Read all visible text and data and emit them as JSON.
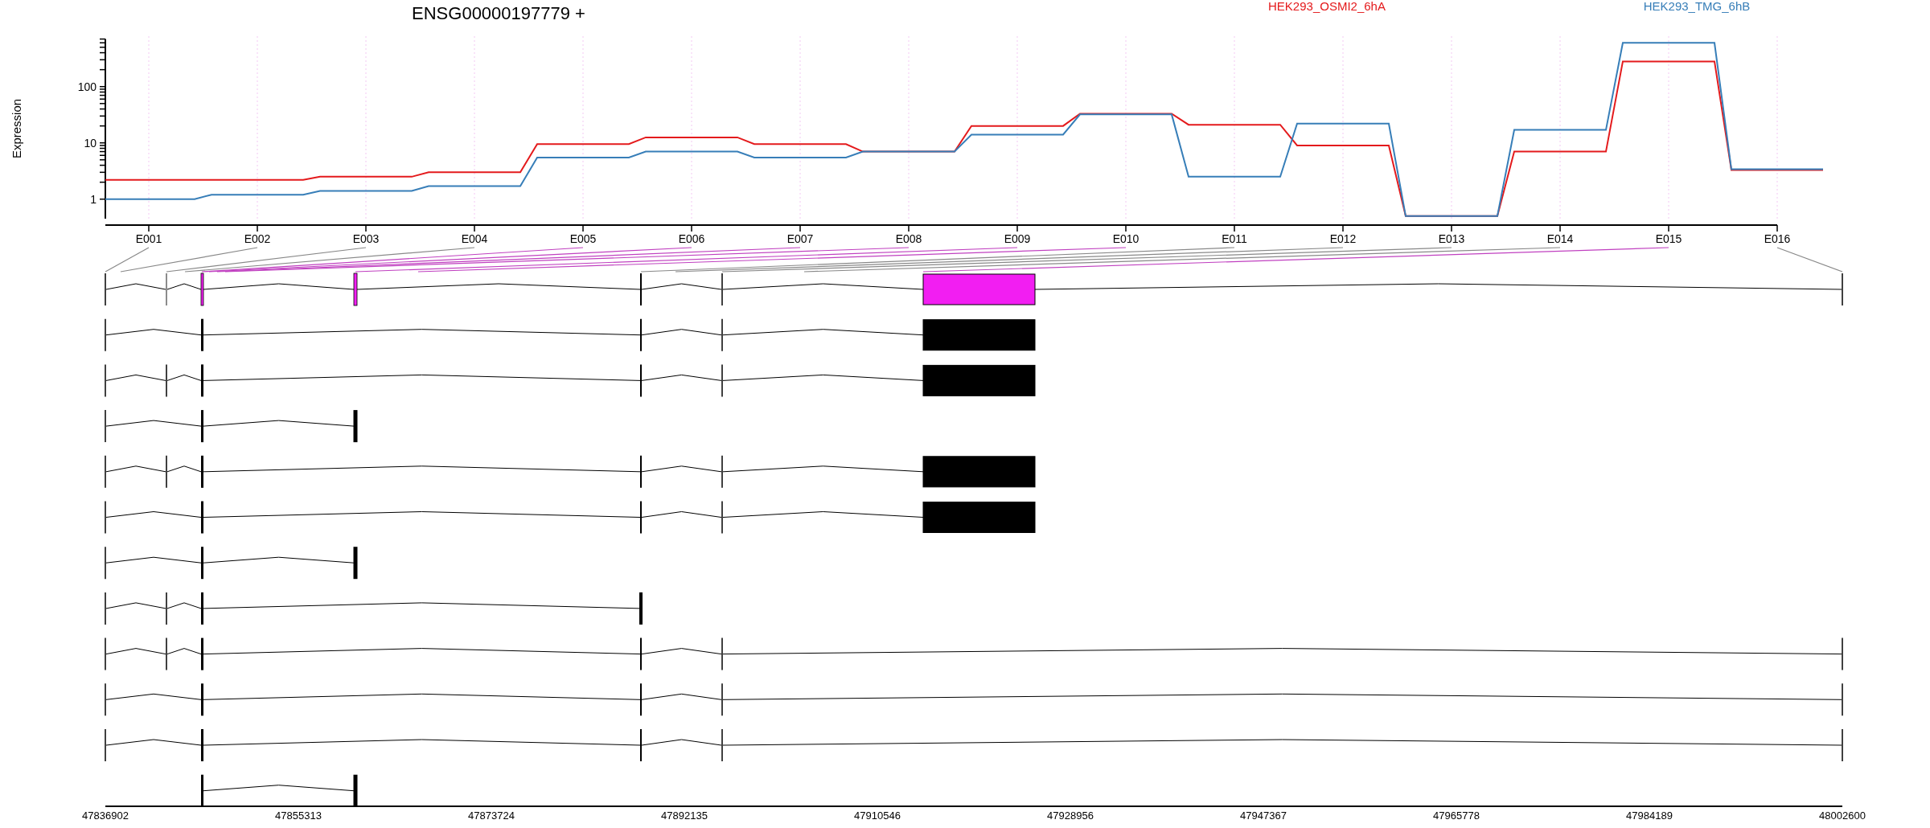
{
  "expression_plot": {
    "title": "ENSG00000197779 +",
    "ylabel": "Expression",
    "legend": [
      {
        "name": "HEK293_OSMI2_6hA",
        "color": "#e41a1c"
      },
      {
        "name": "HEK293_TMG_6hB",
        "color": "#377eb8"
      }
    ],
    "y_tick_labels": [
      "100",
      "10",
      "1"
    ],
    "x_tick_labels": [
      "E001",
      "E002",
      "E003",
      "E004",
      "E005",
      "E006",
      "E007",
      "E008",
      "E009",
      "E010",
      "E011",
      "E012",
      "E013",
      "E014",
      "E015",
      "E016"
    ]
  },
  "gene_model": {
    "axis_labels": [
      "47836902",
      "47855313",
      "47873724",
      "47892135",
      "47910546",
      "47928956",
      "47947367",
      "47965778",
      "47984189",
      "48002600"
    ]
  }
}
